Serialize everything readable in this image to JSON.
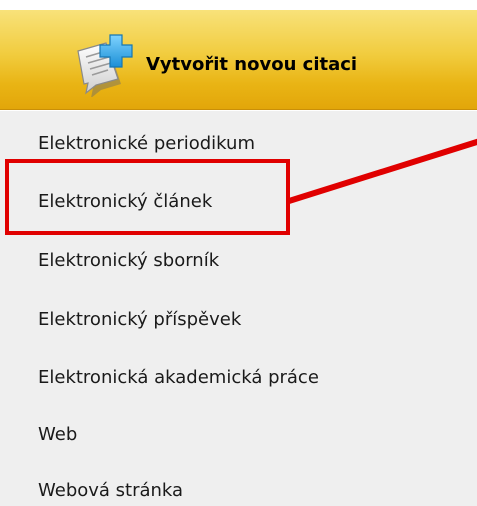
{
  "header": {
    "create_label": "Vytvořit novou citaci",
    "icon": "document-plus-icon",
    "colors": {
      "gradient_top": "#f8e27a",
      "gradient_bottom": "#e2a60a",
      "icon_plus": "#2aa8e8"
    }
  },
  "sidebar": {
    "background": "#efefef",
    "items": [
      {
        "label": "Elektronické periodikum"
      },
      {
        "label": "Elektronický článek"
      },
      {
        "label": "Elektronický sborník"
      },
      {
        "label": "Elektronický příspěvek"
      },
      {
        "label": "Elektronická akademická práce"
      },
      {
        "label": "Web"
      },
      {
        "label": "Webová stránka"
      }
    ]
  },
  "annotation": {
    "highlight_color": "#e00000",
    "highlighted_item": "Elektronický článek"
  }
}
